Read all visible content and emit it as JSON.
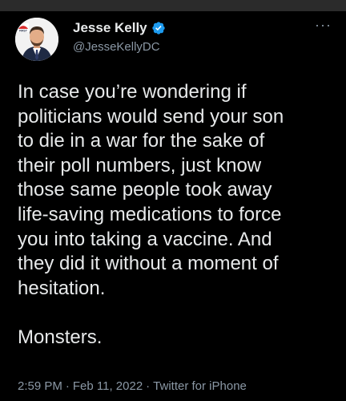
{
  "author": {
    "display_name": "Jesse Kelly",
    "handle": "@JesseKellyDC",
    "avatar_badge": "FIRST",
    "verified_color": "#1d9bf0"
  },
  "tweet": {
    "paragraphs": [
      "In case you’re wondering if\npoliticians would send your son\nto die in a war for the sake of\ntheir poll numbers, just know\nthose same people took away\nlife-saving medications to force\nyou into taking a vaccine. And\nthey did it without a moment of\nhesitation.",
      "Monsters."
    ],
    "time": "2:59 PM",
    "date": "Feb 11, 2022",
    "source": "Twitter for iPhone",
    "separator": "·"
  },
  "icons": {
    "more": "more-horizontal-icon",
    "verified": "verified-badge-icon"
  },
  "more_label": "···",
  "colors": {
    "background": "#000000",
    "text_primary": "#e7e9ea",
    "text_secondary": "#8b98a5",
    "top_strip": "#2b2b2b"
  }
}
